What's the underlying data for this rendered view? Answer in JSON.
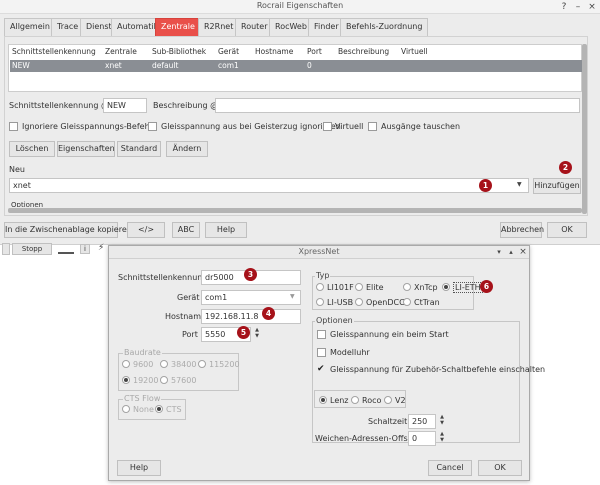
{
  "main": {
    "title": "Rocrail Eigenschaften",
    "tabs": [
      "Allgemein",
      "Trace",
      "Dienst",
      "Automatik",
      "Zentrale",
      "R2Rnet",
      "Router",
      "RocWeb",
      "Finder",
      "Befehls-Zuordnung"
    ],
    "active_tab": "Zentrale",
    "table": {
      "headers": [
        "Schnittstellenkennung",
        "Zentrale",
        "Sub-Bibliothek",
        "Gerät",
        "Hostname",
        "Port",
        "Beschreibung",
        "Virtuell"
      ],
      "row": [
        "NEW",
        "xnet",
        "default",
        "com1",
        "",
        "0",
        "",
        ""
      ]
    },
    "iid_label": "Schnittstellenkennung @",
    "iid_value": "NEW",
    "desc_label": "Beschreibung @",
    "desc_value": "",
    "checkboxes": [
      "Ignoriere Gleisspannungs-Befehle",
      "Gleisspannung aus bei Geisterzug ignorieren",
      "Virtuell",
      "Ausgänge tauschen"
    ],
    "buttons": [
      "Löschen",
      "Eigenschaften",
      "Standard",
      "Ändern"
    ],
    "new_label": "Neu",
    "new_value": "xnet",
    "add_button": "Hinzufügen",
    "options_label": "Optionen",
    "bottom_buttons": [
      "In die Zwischenablage kopieren",
      "</>",
      "ABC",
      "Help"
    ],
    "cancel_button": "Abbrechen",
    "ok_button": "OK",
    "stop_button": "Stopp"
  },
  "dialog": {
    "title": "XpressNet",
    "iid_label": "Schnittstellenkennung",
    "iid_value": "dr5000",
    "device_label": "Gerät",
    "device_value": "com1",
    "hostname_label": "Hostname",
    "hostname_value": "192.168.11.8",
    "port_label": "Port",
    "port_value": "5550",
    "baud_title": "Baudrate",
    "baud_options": [
      "9600",
      "38400",
      "115200",
      "19200",
      "57600"
    ],
    "baud_selected": "19200",
    "cts_title": "CTS Flow",
    "cts_options": [
      "None",
      "CTS"
    ],
    "cts_selected": "CTS",
    "typ_title": "Typ",
    "typ_options": [
      "LI101F",
      "Elite",
      "XnTcp",
      "LI-ETH",
      "LI-USB",
      "OpenDCC",
      "CtTran"
    ],
    "typ_selected": "LI-ETH",
    "options_title": "Optionen",
    "options_checks": [
      "Gleisspannung ein beim Start",
      "Modelluhr",
      "Gleisspannung für Zubehör-Schaltbefehle einschalten"
    ],
    "options_checked": [
      false,
      false,
      true
    ],
    "lenz_options": [
      "Lenz",
      "Roco",
      "V2"
    ],
    "lenz_selected": "Lenz",
    "switchtime_label": "Schaltzeit",
    "switchtime_value": "250",
    "offset_label": "Weichen-Adressen-Offset",
    "offset_value": "0",
    "help_button": "Help",
    "cancel_button": "Cancel",
    "ok_button": "OK"
  },
  "badges": [
    "1",
    "2",
    "3",
    "4",
    "5",
    "6"
  ],
  "colors": {
    "active_tab": "#e9504a",
    "badge": "#a6121a",
    "selected_row": "#8a8e94"
  }
}
